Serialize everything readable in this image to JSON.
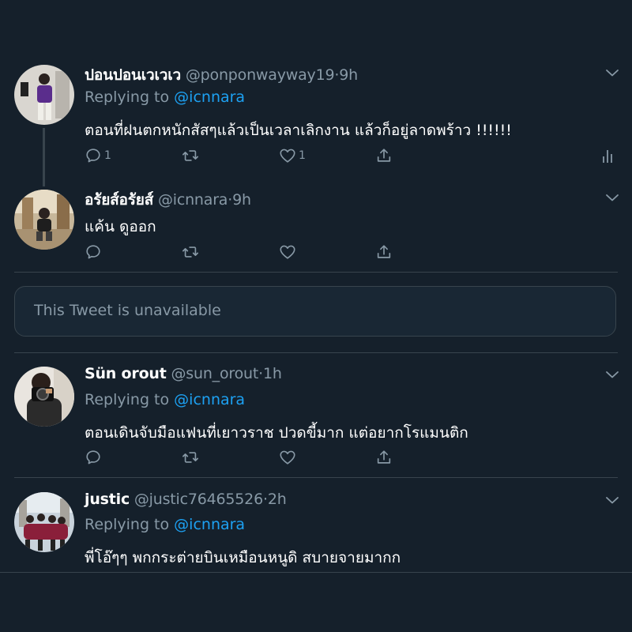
{
  "tweets": [
    {
      "name": "ปอนปอนเวเวเว",
      "handle": "@ponponwayway19",
      "time": "9h",
      "replying_label": "Replying to",
      "replying_handle": "@icnnara",
      "text": "ตอนที่ฝนตกหนักสัสๆแล้วเป็นเวลาเลิกงาน แล้วก็อยู่ลาดพร้าว !!!!!!",
      "reply_count": "1",
      "like_count": "1"
    },
    {
      "name": "อรัยส์อรัยส์",
      "handle": "@icnnara",
      "time": "9h",
      "text": "แค้น ดูออก"
    },
    {
      "name": "Sün orout",
      "handle": "@sun_orout",
      "time": "1h",
      "replying_label": "Replying to",
      "replying_handle": "@icnnara",
      "text": "ตอนเดินจับมือแฟนที่เยาวราช ปวดขี้มาก แต่อยากโรแมนติก"
    },
    {
      "name": "justic",
      "handle": "@justic76465526",
      "time": "2h",
      "replying_label": "Replying to",
      "replying_handle": "@icnnara",
      "text": "พี่โอ๊ๆๆ พกกระต่ายบินเหมือนหนูดิ สบายจายมากก"
    }
  ],
  "unavailable": "This Tweet is unavailable",
  "colors": {
    "background": "#15202b",
    "muted": "#8899a6",
    "accent": "#1da1f2",
    "border": "#38444d"
  },
  "icons": [
    "reply-icon",
    "retweet-icon",
    "like-icon",
    "share-icon",
    "analytics-icon",
    "chevron-down-icon"
  ]
}
